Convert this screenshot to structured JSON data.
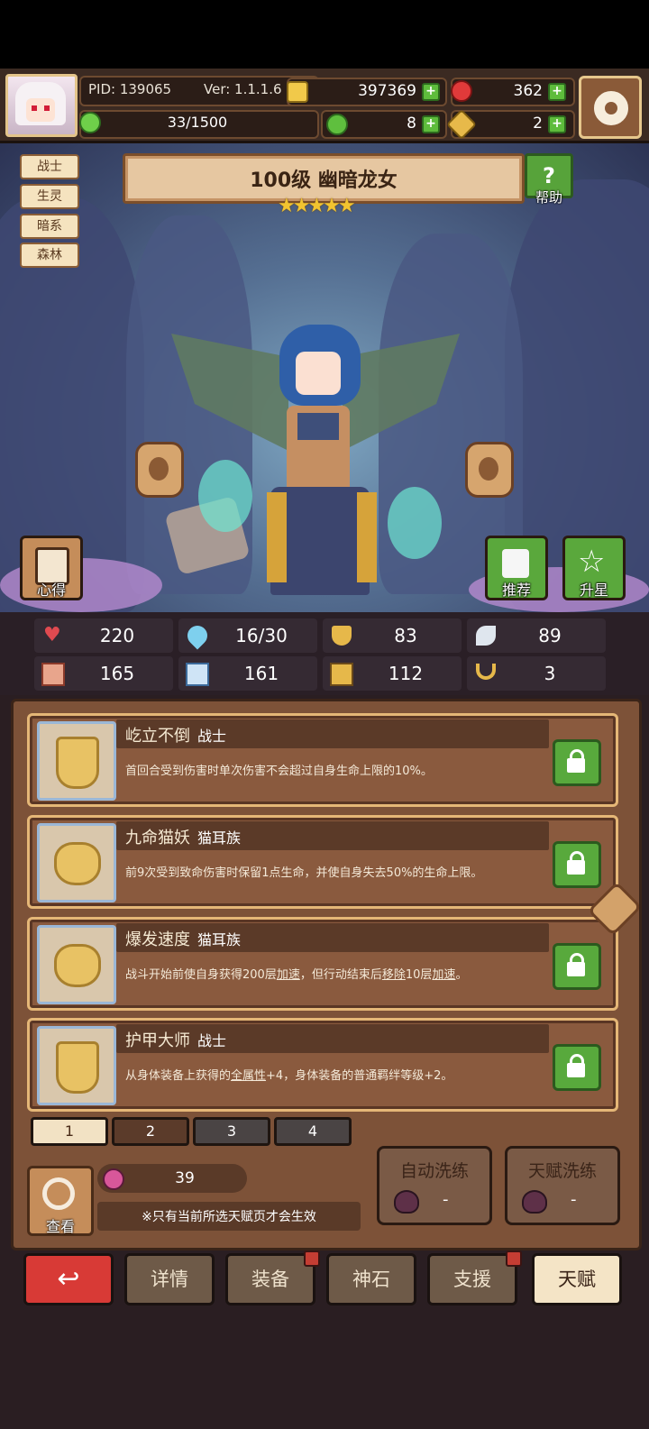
{
  "header": {
    "pid": "PID: 139065",
    "version": "Ver: 1.1.1.6",
    "energy": "33/1500",
    "gold": "397369",
    "gems": "362",
    "clover": "8",
    "pieces": "2"
  },
  "hero": {
    "tags": [
      "战士",
      "生灵",
      "暗系",
      "森林"
    ],
    "title": "100级 幽暗龙女",
    "stars": "★★★★★",
    "help_label": "帮助",
    "insight_label": "心得",
    "recommend_label": "推荐",
    "upstar_label": "升星"
  },
  "stats": {
    "hp": "220",
    "mana": "16/30",
    "armor": "83",
    "speed": "89",
    "attack": "165",
    "magic": "161",
    "equip": "112",
    "luck": "3"
  },
  "talents": [
    {
      "name": "屹立不倒",
      "type": "战士",
      "desc": "首回合受到伤害时单次伤害不会超过自身生命上限的10%。"
    },
    {
      "name": "九命猫妖",
      "type": "猫耳族",
      "desc": "前9次受到致命伤害时保留1点生命，并使自身失去50%的生命上限。"
    },
    {
      "name": "爆发速度",
      "type": "猫耳族",
      "desc_pre": "战斗开始前使自身获得200层",
      "desc_u1": "加速",
      "desc_mid": "，但行动结束后",
      "desc_u2": "移除",
      "desc_mid2": "10层",
      "desc_u3": "加速",
      "desc_post": "。"
    },
    {
      "name": "护甲大师",
      "type": "战士",
      "desc_pre": "从身体装备上获得的",
      "desc_u1": "全属性",
      "desc_post": "+4，身体装备的普通羁绊等级+2。"
    }
  ],
  "pages": [
    "1",
    "2",
    "3",
    "4"
  ],
  "bottom": {
    "view_label": "查看",
    "shard_count": "39",
    "note": "※只有当前所选天赋页才会生效",
    "auto_wash": "自动洗练",
    "talent_wash": "天赋洗练",
    "auto_cost": "-",
    "talent_cost": "-"
  },
  "nav": {
    "details": "详情",
    "equipment": "装备",
    "godstone": "神石",
    "support": "支援",
    "talent": "天赋"
  },
  "colors": {
    "accent_gold": "#e5b777",
    "green_button": "#58a93c",
    "back_red": "#d83a36"
  }
}
